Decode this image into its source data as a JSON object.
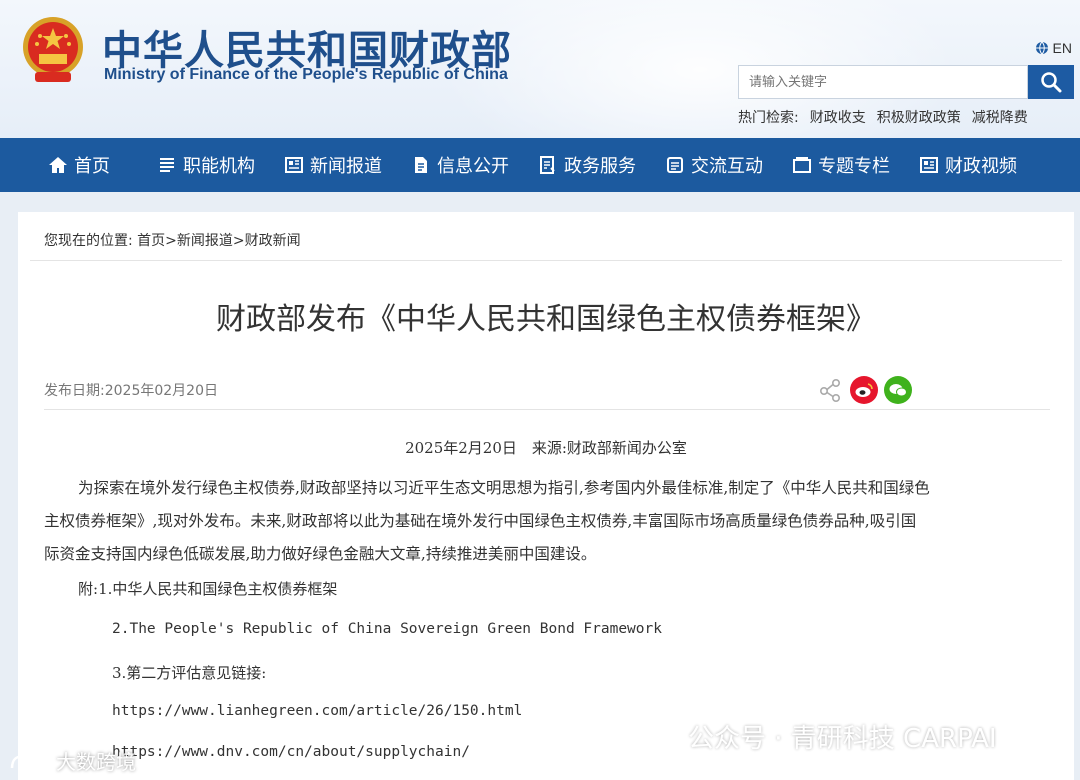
{
  "header": {
    "title_cn": "中华人民共和国财政部",
    "title_en": "Ministry of Finance of the People's Republic of China",
    "lang_label": "EN",
    "search_placeholder": "请输入关键字",
    "hot_label": "热门检索:",
    "hot_links": [
      "财政收支",
      "积极财政政策",
      "减税降费"
    ]
  },
  "nav": {
    "items": [
      {
        "label": "首页",
        "icon": "home-icon"
      },
      {
        "label": "职能机构",
        "icon": "list-icon"
      },
      {
        "label": "新闻报道",
        "icon": "newspaper-icon"
      },
      {
        "label": "信息公开",
        "icon": "document-icon"
      },
      {
        "label": "政务服务",
        "icon": "service-icon"
      },
      {
        "label": "交流互动",
        "icon": "chat-icon"
      },
      {
        "label": "专题专栏",
        "icon": "folder-icon"
      },
      {
        "label": "财政视频",
        "icon": "video-icon"
      }
    ]
  },
  "breadcrumb": {
    "prefix": "您现在的位置:",
    "path": "首页>新闻报道>财政新闻"
  },
  "article": {
    "title": "财政部发布《中华人民共和国绿色主权债券框架》",
    "pub_label": "发布日期:",
    "pub_date": "2025年02月20日",
    "byline": "2025年2月20日　来源:财政部新闻办公室",
    "body_lines": [
      "为探索在境外发行绿色主权债券,财政部坚持以习近平生态文明思想为指引,参考国内外最佳标准,制定了《中华人民共和国绿色",
      "主权债券框架》,现对外发布。未来,财政部将以此为基础在境外发行中国绿色主权债券,丰富国际市场高质量绿色债券品种,吸引国",
      "际资金支持国内绿色低碳发展,助力做好绿色金融大文章,持续推进美丽中国建设。"
    ],
    "attachments": {
      "prefix": "附:",
      "item1": "1.中华人民共和国绿色主权债券框架",
      "item2": "2.The People's Republic of China Sovereign Green Bond Framework",
      "item3": "3.第二方评估意见链接:",
      "link1": "https://www.lianhegreen.com/article/26/150.html",
      "link2": "https://www.dnv.com/cn/about/supplychain/"
    }
  },
  "watermarks": {
    "right": "公众号 · 青研科技 CARPAI",
    "left": "大数跨境"
  },
  "colors": {
    "brand_blue": "#1c5a9f",
    "title_blue": "#1f4f8c",
    "weibo_red": "#e6162d",
    "wechat_green": "#3fb21c"
  }
}
